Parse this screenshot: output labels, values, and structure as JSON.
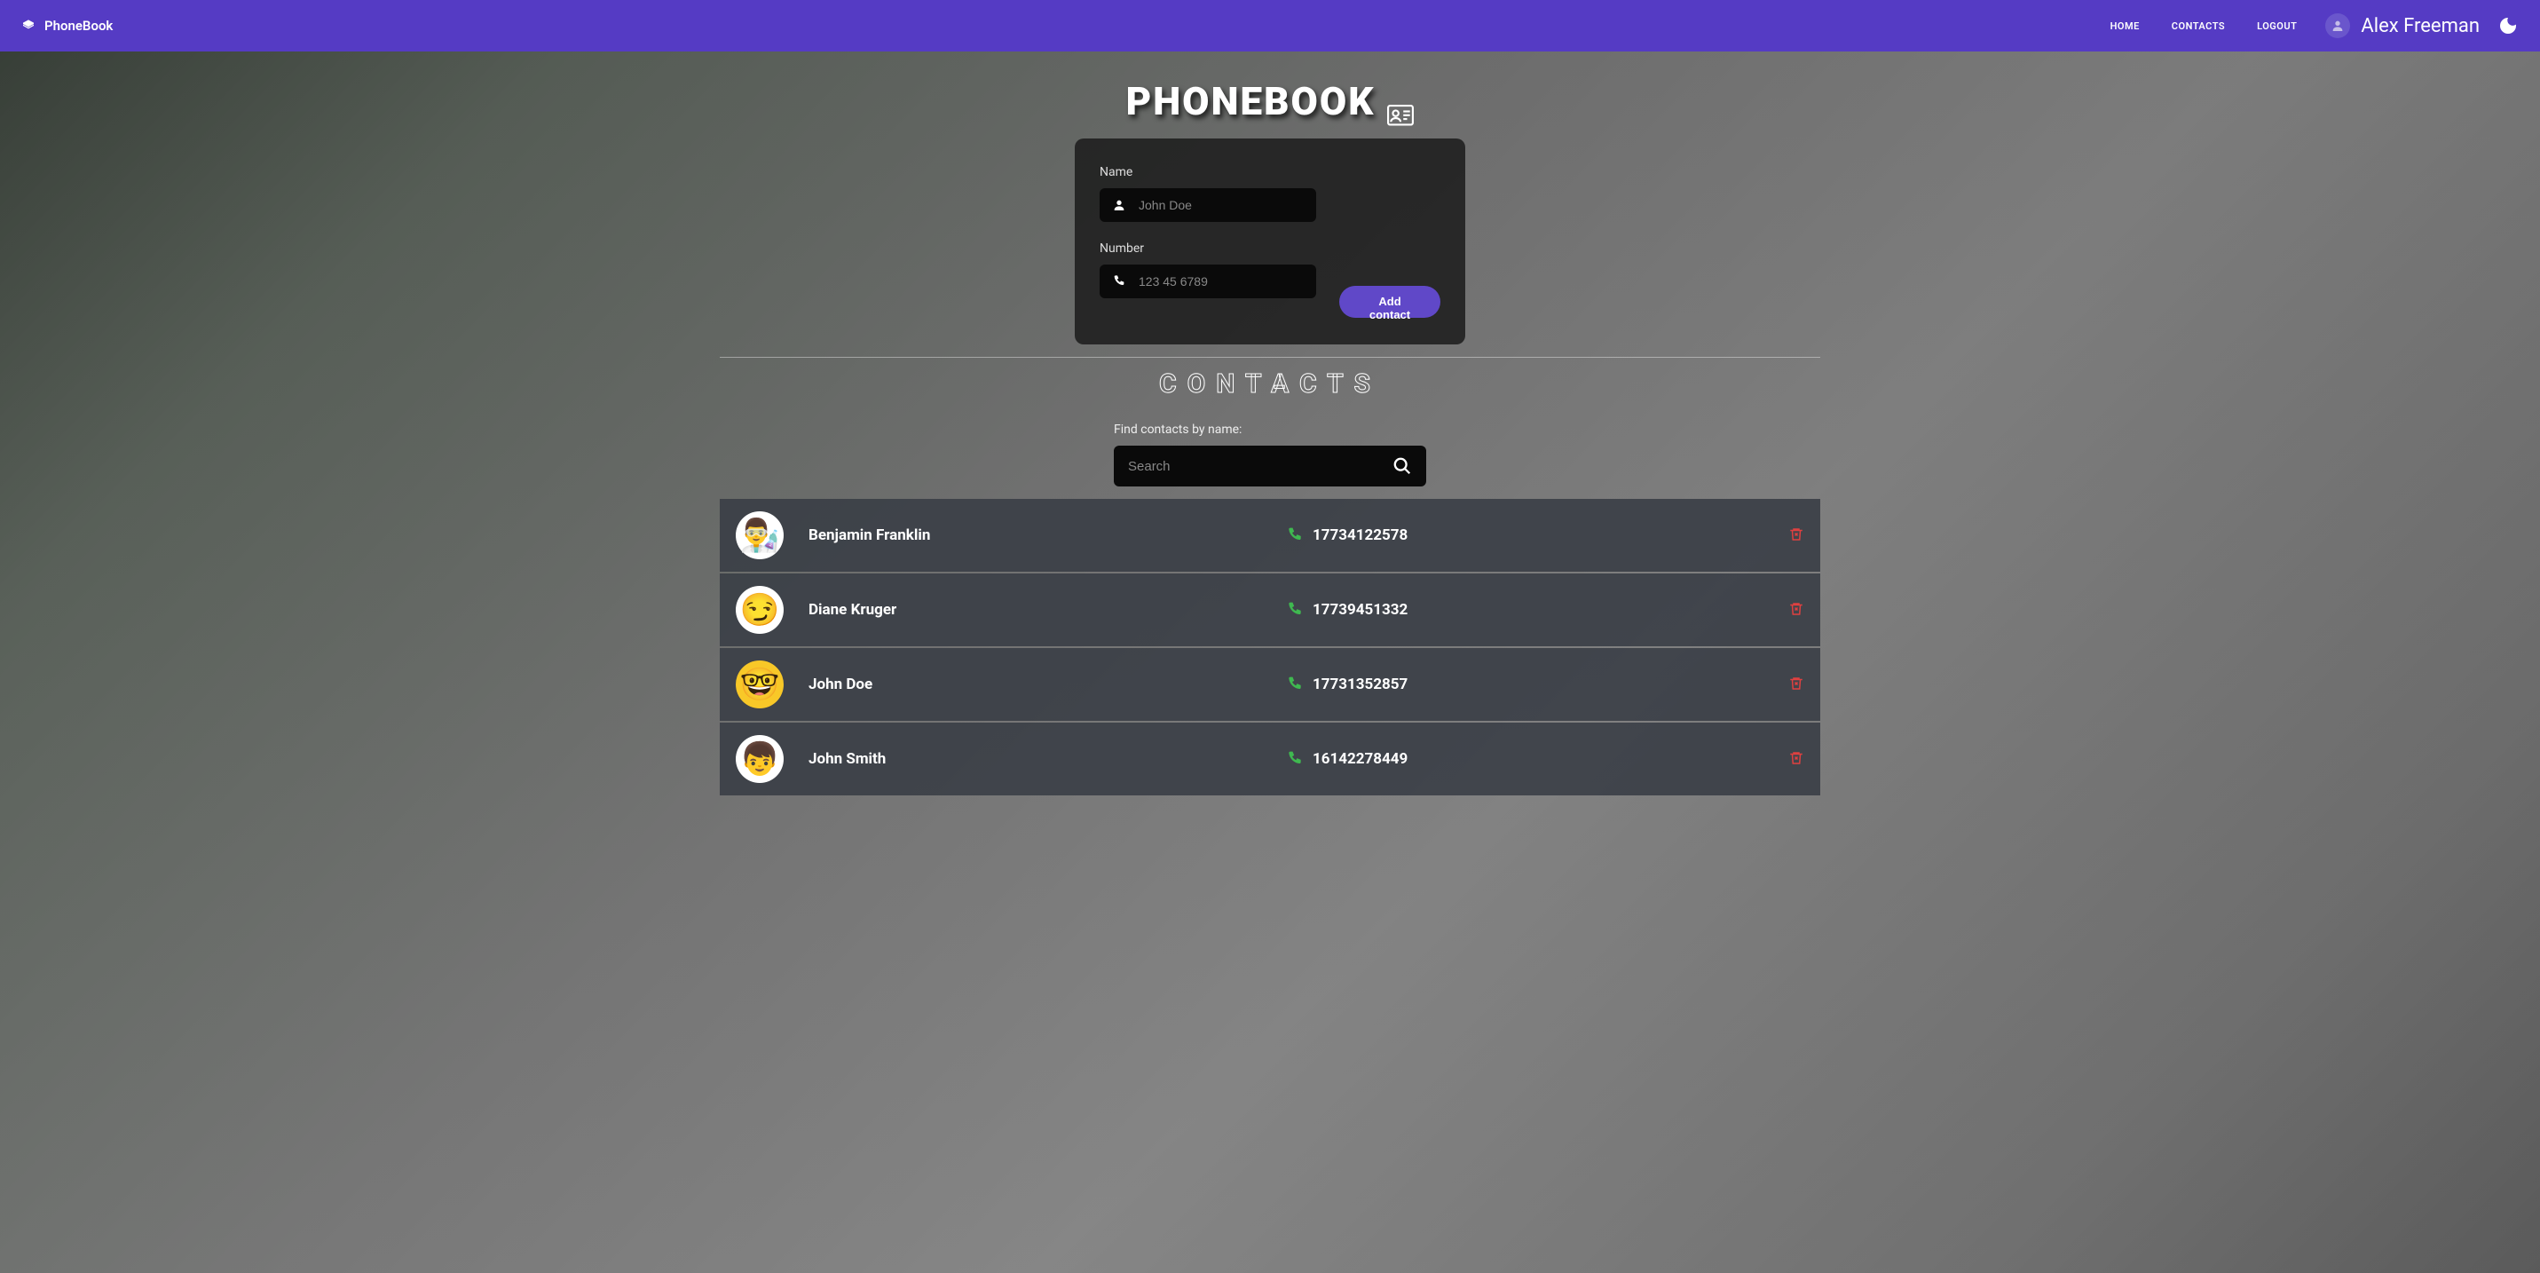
{
  "header": {
    "brand": "PhoneBook",
    "nav": {
      "home": "HOME",
      "contacts": "CONTACTS",
      "logout": "LOGOUT"
    },
    "user_name": "Alex Freeman"
  },
  "main": {
    "title": "PHONEBOOK",
    "form": {
      "name_label": "Name",
      "name_placeholder": "John Doe",
      "number_label": "Number",
      "number_placeholder": "123 45 6789",
      "add_button": "Add contact"
    },
    "contacts_title": "CONTACTS",
    "search_label": "Find contacts by name:",
    "search_placeholder": "Search"
  },
  "contacts": [
    {
      "name": "Benjamin Franklin",
      "phone": "17734122578",
      "avatar_emoji": "👨‍🔬"
    },
    {
      "name": "Diane Kruger",
      "phone": "17739451332",
      "avatar_emoji": "😏"
    },
    {
      "name": "John Doe",
      "phone": "17731352857",
      "avatar_emoji": "🤓"
    },
    {
      "name": "John Smith",
      "phone": "16142278449",
      "avatar_emoji": "👦"
    }
  ]
}
